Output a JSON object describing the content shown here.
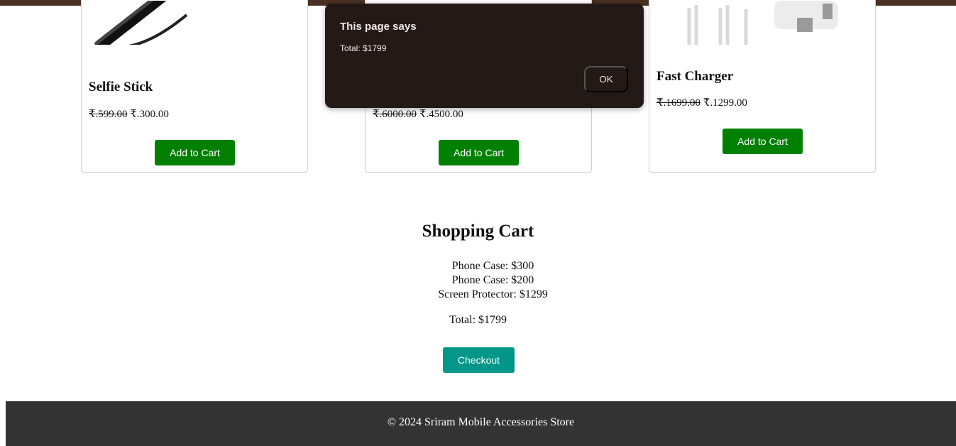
{
  "products": [
    {
      "name": "Selfie Stick",
      "old_price": "₹.599.00",
      "new_price": "₹.300.00",
      "button": "Add to Cart",
      "image_icon": "selfie-stick-image"
    },
    {
      "name": "",
      "old_price": "₹.6000.00",
      "new_price": "₹.4500.00",
      "button": "Add to Cart",
      "image_icon": "product-image"
    },
    {
      "name": "Fast Charger",
      "old_price": "₹.1699.00",
      "new_price": "₹.1299.00",
      "button": "Add to Cart",
      "image_icon": "charger-image"
    }
  ],
  "cart": {
    "title": "Shopping Cart",
    "items": [
      "Phone Case: $300",
      "Phone Case: $200",
      "Screen Protector: $1299"
    ],
    "total": "Total: $1799",
    "checkout_label": "Checkout"
  },
  "footer": {
    "text": "© 2024 Sriram Mobile Accessories Store"
  },
  "dialog": {
    "title": "This page says",
    "message": "Total: $1799",
    "ok_label": "OK"
  },
  "colors": {
    "cart_button": "#008000",
    "checkout_button": "#00968a",
    "footer": "#333333",
    "dialog_bg": "#231a18",
    "dialog_ok": "#f6b08d"
  }
}
